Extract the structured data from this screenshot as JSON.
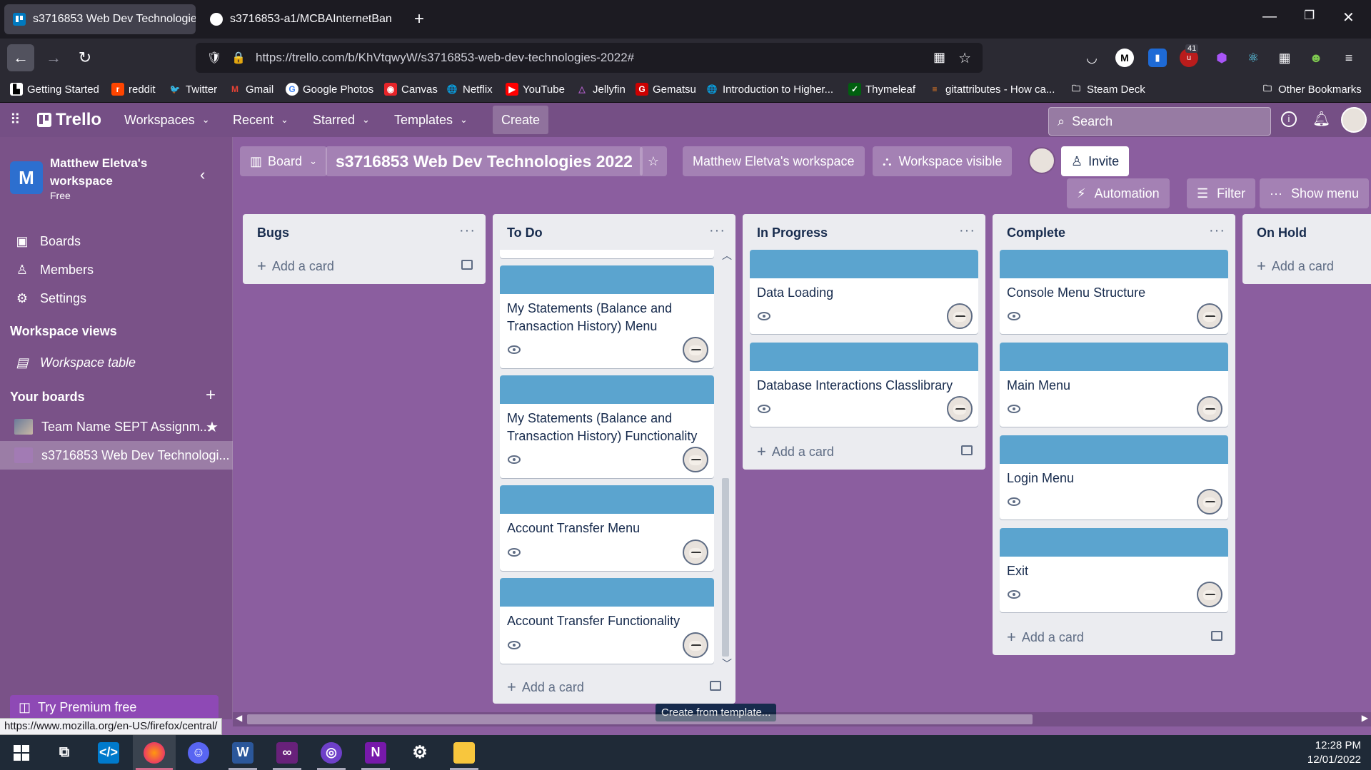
{
  "browser": {
    "tabs": [
      {
        "title": "s3716853 Web Dev Technologie",
        "active": true
      },
      {
        "title": "s3716853-a1/MCBAInternetBan",
        "active": false
      }
    ],
    "url": "https://trello.com/b/KhVtqwyW/s3716853-web-dev-technologies-2022#",
    "extension_badge": "41",
    "bookmarks": [
      "Getting Started",
      "reddit",
      "Twitter",
      "Gmail",
      "Google Photos",
      "Canvas",
      "Netflix",
      "YouTube",
      "Jellyfin",
      "Gematsu",
      "Introduction to Higher...",
      "Thymeleaf",
      "gitattributes - How ca...",
      "Steam Deck"
    ],
    "other_bookmarks": "Other Bookmarks",
    "status_url": "https://www.mozilla.org/en-US/firefox/central/"
  },
  "trello_header": {
    "logo": "Trello",
    "menus": [
      "Workspaces",
      "Recent",
      "Starred",
      "Templates"
    ],
    "create": "Create",
    "search_placeholder": "Search"
  },
  "sidebar": {
    "workspace_initial": "M",
    "workspace_name_1": "Matthew Eletva's",
    "workspace_name_2": "workspace",
    "plan": "Free",
    "items": [
      "Boards",
      "Members",
      "Settings"
    ],
    "views_heading": "Workspace views",
    "views": [
      "Workspace table"
    ],
    "boards_heading": "Your boards",
    "boards": [
      "Team Name SEPT Assignm...",
      "s3716853 Web Dev Technologi..."
    ],
    "premium": "Try Premium free"
  },
  "board": {
    "view": "Board",
    "title": "s3716853 Web Dev Technologies 2022",
    "workspace": "Matthew Eletva's workspace",
    "visibility": "Workspace visible",
    "invite": "Invite",
    "automation": "Automation",
    "filter": "Filter",
    "show_menu": "Show menu",
    "add_card": "Add a card",
    "tooltip": "Create from template...",
    "lists": [
      {
        "title": "Bugs",
        "cards": []
      },
      {
        "title": "To Do",
        "cards": [
          "My Statements (Balance and",
          "Transaction History) Menu",
          "My Statements (Balance and",
          "Transaction History) Functionality",
          "Account Transfer Menu",
          "Account Transfer Functionality"
        ]
      },
      {
        "title": "In Progress",
        "cards": [
          "Data Loading",
          "Database Interactions Classlibrary"
        ]
      },
      {
        "title": "Complete",
        "cards": [
          "Console Menu Structure",
          "Main Menu",
          "Login Menu",
          "Exit"
        ]
      },
      {
        "title": "On Hold",
        "cards": []
      }
    ]
  },
  "taskbar": {
    "time": "12:28 PM",
    "date": "12/01/2022"
  },
  "colors": {
    "board_bg": "#8b5e9f",
    "header_bg": "#754f85",
    "card_cover": "#5ba4cf",
    "list_bg": "#ebecf0"
  }
}
